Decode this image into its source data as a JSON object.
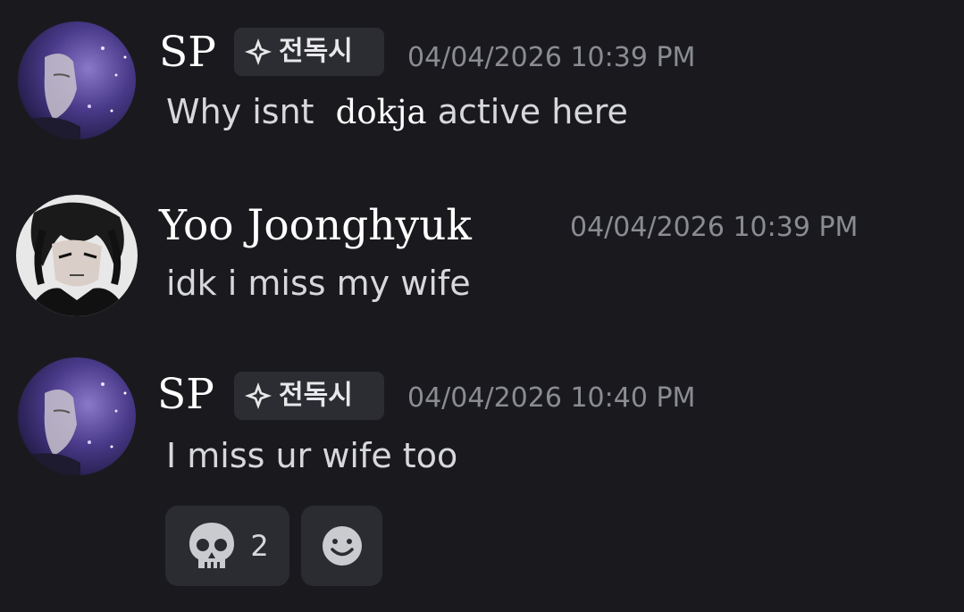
{
  "messages": [
    {
      "author": "SP",
      "tag": "전독시",
      "timestamp": "04/04/2026 10:39 PM",
      "text_before": "Why isnt",
      "text_highlight": "dokja",
      "text_after": "active here"
    },
    {
      "author": "Yoo Joonghyuk",
      "timestamp": "04/04/2026 10:39 PM",
      "text": "idk i miss my wife"
    },
    {
      "author": "SP",
      "tag": "전독시",
      "timestamp": "04/04/2026 10:40 PM",
      "text": "I miss ur wife too",
      "reactions": [
        {
          "icon": "skull-icon",
          "count": "2"
        },
        {
          "icon": "add-reaction-icon"
        }
      ]
    }
  ],
  "colors": {
    "background": "#1a1a1e",
    "text": "#d7d8dc",
    "timestamp": "#8a8c93",
    "tag_bg": "#2c2d33",
    "reaction_bg": "#2b2c31"
  }
}
